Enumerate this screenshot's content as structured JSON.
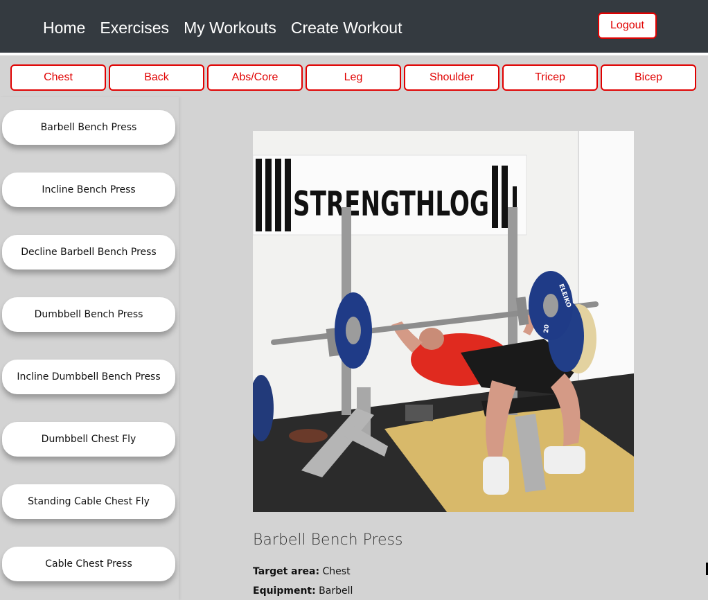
{
  "nav": {
    "links": [
      "Home",
      "Exercises",
      "My Workouts",
      "Create Workout"
    ],
    "logout_label": "Logout"
  },
  "categories": [
    "Chest",
    "Back",
    "Abs/Core",
    "Leg",
    "Shoulder",
    "Tricep",
    "Bicep"
  ],
  "exercises": [
    "Barbell Bench Press",
    "Incline Bench Press",
    "Decline Barbell Bench Press",
    "Dumbbell Bench Press",
    "Incline Dumbbell Bench Press",
    "Dumbbell Chest Fly",
    "Standing Cable Chest Fly",
    "Cable Chest Press"
  ],
  "detail": {
    "title": "Barbell Bench Press",
    "image_sign": "STRENGTHLOG",
    "plate_brand": "ELEIKO",
    "plate_weight": "20",
    "target_label": "Target area:",
    "target_value": "Chest",
    "equipment_label": "Equipment:",
    "equipment_value": "Barbell"
  },
  "colors": {
    "navbar": "#343a40",
    "accent": "#e00000",
    "page_bg": "#d3d3d3"
  }
}
